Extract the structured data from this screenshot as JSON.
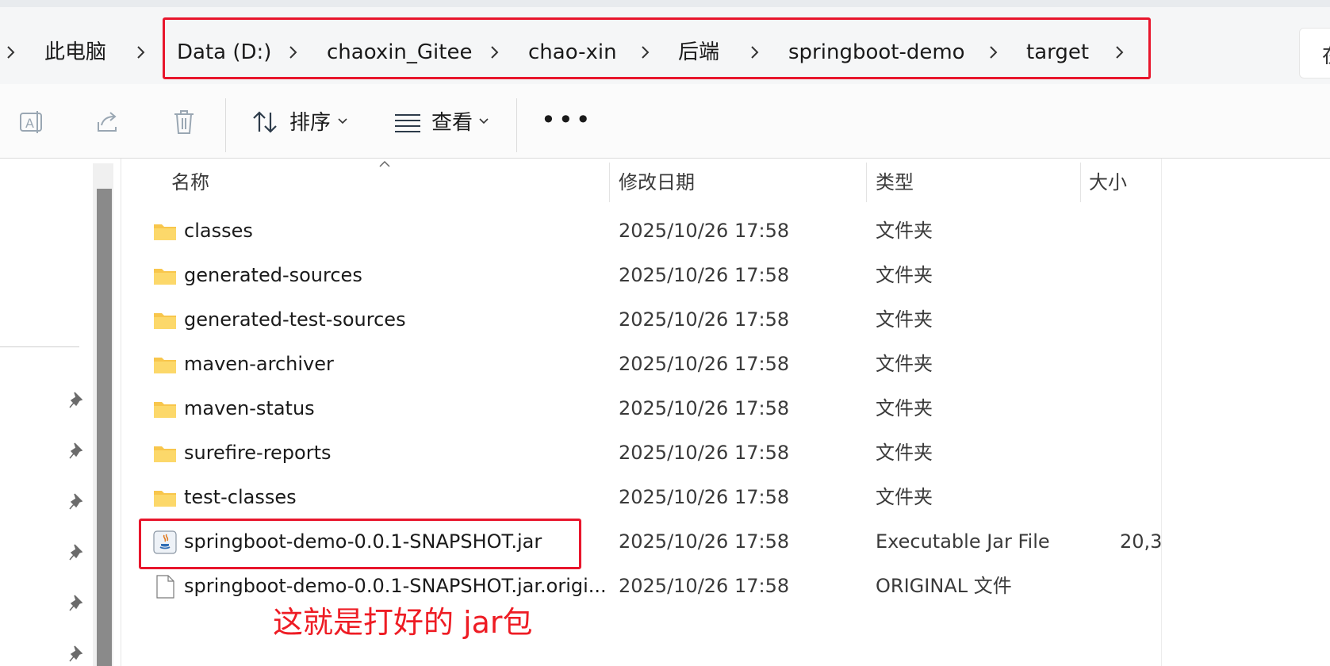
{
  "breadcrumb": {
    "items": [
      "此电脑",
      "Data (D:)",
      "chaoxin_Gitee",
      "chao-xin",
      "后端",
      "springboot-demo",
      "target"
    ],
    "search_partial": "在"
  },
  "toolbar": {
    "sort_label": "排序",
    "view_label": "查看",
    "more_label": "•••",
    "icons": [
      "rename-icon",
      "share-icon",
      "delete-icon",
      "sort-icon",
      "view-icon",
      "more-icon"
    ]
  },
  "file_list": {
    "columns": [
      "名称",
      "修改日期",
      "类型",
      "大小"
    ],
    "rows": [
      {
        "name": "classes",
        "date": "2025/10/26 17:58",
        "type": "文件夹",
        "size": "",
        "icon": "folder-icon"
      },
      {
        "name": "generated-sources",
        "date": "2025/10/26 17:58",
        "type": "文件夹",
        "size": "",
        "icon": "folder-icon"
      },
      {
        "name": "generated-test-sources",
        "date": "2025/10/26 17:58",
        "type": "文件夹",
        "size": "",
        "icon": "folder-icon"
      },
      {
        "name": "maven-archiver",
        "date": "2025/10/26 17:58",
        "type": "文件夹",
        "size": "",
        "icon": "folder-icon"
      },
      {
        "name": "maven-status",
        "date": "2025/10/26 17:58",
        "type": "文件夹",
        "size": "",
        "icon": "folder-icon"
      },
      {
        "name": "surefire-reports",
        "date": "2025/10/26 17:58",
        "type": "文件夹",
        "size": "",
        "icon": "folder-icon"
      },
      {
        "name": "test-classes",
        "date": "2025/10/26 17:58",
        "type": "文件夹",
        "size": "",
        "icon": "folder-icon"
      },
      {
        "name": "springboot-demo-0.0.1-SNAPSHOT.jar",
        "date": "2025/10/26 17:58",
        "type": "Executable Jar File",
        "size": "20,3",
        "icon": "java-jar-icon"
      },
      {
        "name": "springboot-demo-0.0.1-SNAPSHOT.jar.origi...",
        "date": "2025/10/26 17:58",
        "type": "ORIGINAL 文件",
        "size": "",
        "icon": "file-icon"
      }
    ]
  },
  "annotation": {
    "text": "这就是打好的 jar包",
    "color": "#ee1c24"
  },
  "colors": {
    "highlight_border": "#e8162c",
    "folder": "#f8c64c"
  }
}
